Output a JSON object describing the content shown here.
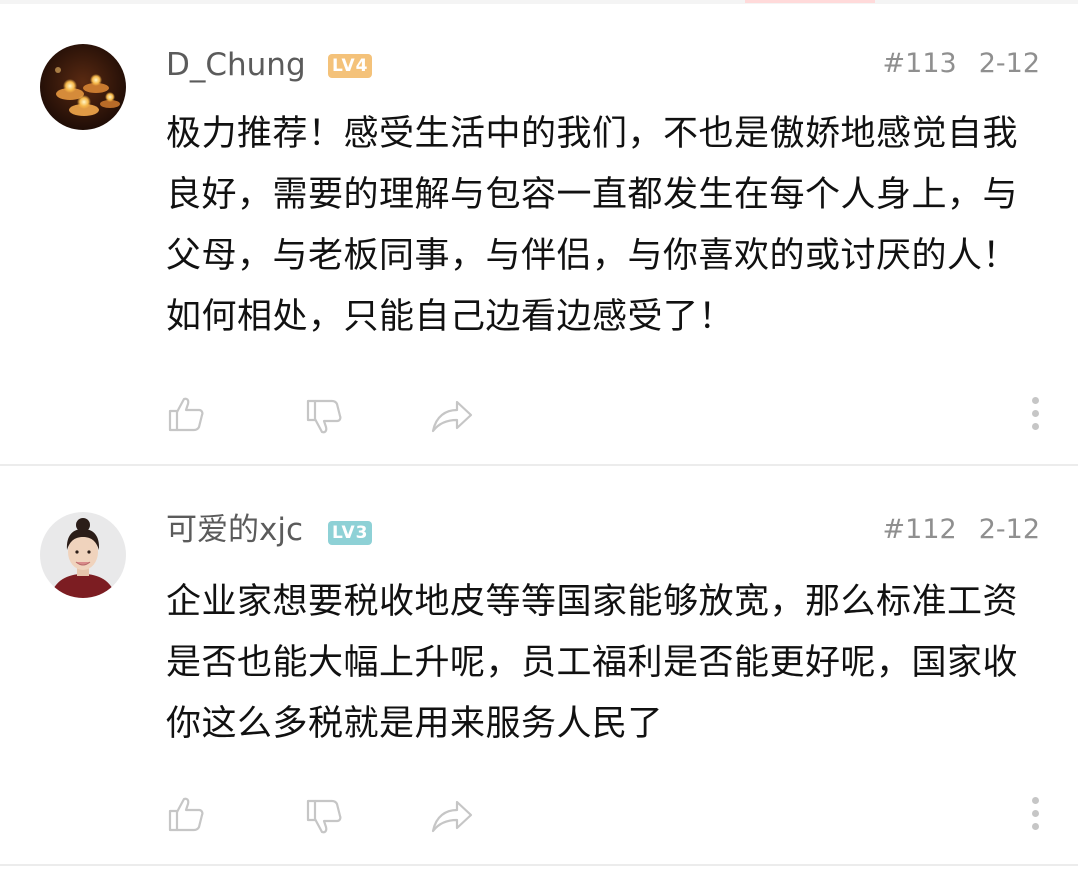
{
  "comments": [
    {
      "username": "D_Chung",
      "level": "LV4",
      "floor": "#113",
      "date": "2-12",
      "lines": [
        "极力推荐！感受生活中的我们，不也是傲娇地感觉自我",
        "良好，需要的理解与包容一直都发生在每个人身上，与",
        "父母，与老板同事，与伴侣，与你喜欢的或讨厌的人！",
        "如何相处，只能自己边看边感受了！"
      ],
      "avatar": "candles-avatar"
    },
    {
      "username": "可爱的xjc",
      "level": "LV3",
      "floor": "#112",
      "date": "2-12",
      "lines": [
        "企业家想要税收地皮等等国家能够放宽，那么标准工资",
        "是否也能大幅上升呢，员工福利是否能更好呢，国家收",
        "你这么多税就是用来服务人民了"
      ],
      "avatar": "girl-portrait-avatar"
    }
  ],
  "icons": {
    "like": "thumbs-up-icon",
    "dislike": "thumbs-down-icon",
    "share": "share-arrow-icon",
    "more": "more-vertical-icon"
  },
  "colors": {
    "lv4_badge": "#f4c27a",
    "lv3_badge": "#8ed1d6",
    "divider": "#ececec",
    "icon_gray": "#c6c6c6"
  }
}
